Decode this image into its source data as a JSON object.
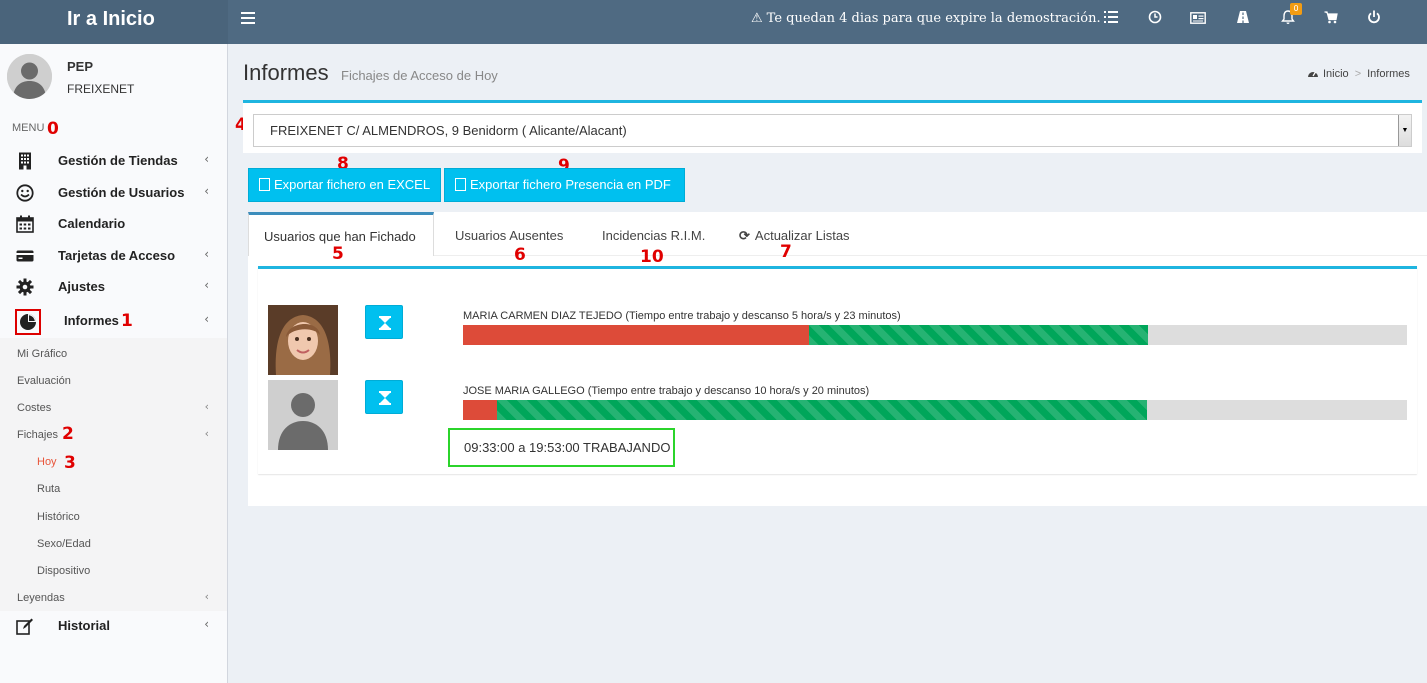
{
  "header": {
    "brand": "Ir a Inicio",
    "demo_message": "Te quedan 4 dias para que expire la demostración.",
    "notification_count": "0",
    "icons": [
      "list-icon",
      "clock-icon",
      "id-card-icon",
      "road-icon",
      "bell-icon",
      "cart-icon",
      "power-icon"
    ]
  },
  "sidebar": {
    "user_name": "PEP",
    "user_company": "FREIXENET",
    "menu_header": "MENU",
    "items": [
      {
        "label": "Gestión de Tiendas",
        "icon": "building-icon",
        "has_chevron": true
      },
      {
        "label": "Gestión de Usuarios",
        "icon": "smile-icon",
        "has_chevron": true
      },
      {
        "label": "Calendario",
        "icon": "calendar-icon",
        "has_chevron": false
      },
      {
        "label": "Tarjetas de Acceso",
        "icon": "credit-card-icon",
        "has_chevron": true
      },
      {
        "label": "Ajustes",
        "icon": "gear-icon",
        "has_chevron": true
      },
      {
        "label": "Informes",
        "icon": "pie-chart-icon",
        "has_chevron": true
      },
      {
        "label": "Historial",
        "icon": "edit-icon",
        "has_chevron": true
      }
    ],
    "submenu": [
      "Mi Gráfico",
      "Evaluación",
      "Costes",
      "Fichajes",
      "Hoy",
      "Ruta",
      "Histórico",
      "Sexo/Edad",
      "Dispositivo",
      "Leyendas"
    ],
    "active_color": "#e8553a"
  },
  "page": {
    "title": "Informes",
    "subtitle": "Fichajes de Acceso de Hoy",
    "breadcrumb_home": "Inicio",
    "breadcrumb_sep": ">",
    "breadcrumb_current": "Informes"
  },
  "store_select": {
    "value": "FREIXENET C/ ALMENDROS, 9 Benidorm ( Alicante/Alacant)"
  },
  "export": {
    "excel_label": "Exportar fichero en EXCEL",
    "pdf_label": "Exportar fichero Presencia en PDF"
  },
  "tabs": [
    {
      "label": "Usuarios que han Fichado",
      "active": true
    },
    {
      "label": "Usuarios Ausentes",
      "active": false
    },
    {
      "label": "Incidencias R.I.M.",
      "active": false
    },
    {
      "label": "Actualizar Listas",
      "active": false
    }
  ],
  "records": [
    {
      "name_text": "MARIA CARMEN DIAZ TEJEDO (Tiempo entre trabajo y descanso 5 hora/s y 23 minutos)",
      "red_fraction": 0.366,
      "green_fraction": 0.359
    },
    {
      "name_text": "JOSE MARIA GALLEGO (Tiempo entre trabajo y descanso 10 hora/s y 20 minutos)",
      "red_fraction": 0.036,
      "green_fraction": 0.689
    }
  ],
  "tooltip": "09:33:00 a 19:53:00 TRABAJANDO",
  "annotations": [
    "0",
    "1",
    "2",
    "3",
    "4",
    "5",
    "6",
    "7",
    "8",
    "9",
    "10"
  ],
  "colors": {
    "header": "#4f6a82",
    "accent": "#00c0ef",
    "red_bar": "#dd4b39",
    "green_bar": "#00a65a",
    "annotation": "#e00000"
  }
}
